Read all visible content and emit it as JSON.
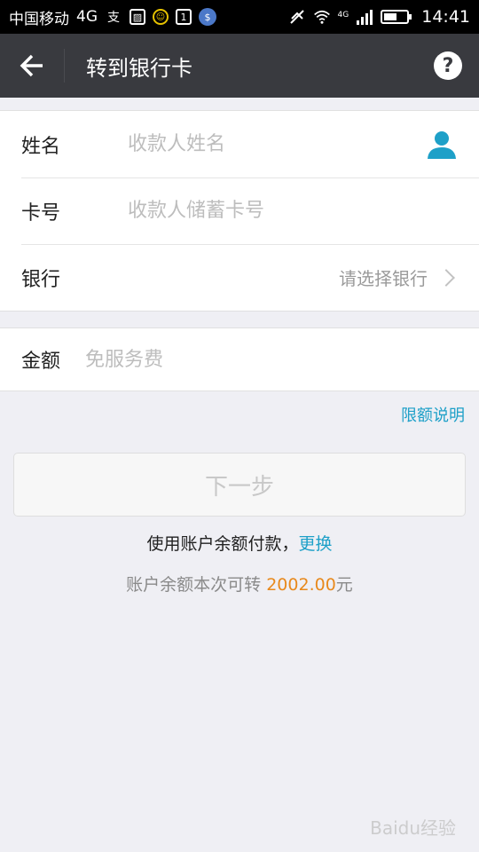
{
  "status_bar": {
    "carrier": "中国移动",
    "network": "4G",
    "network_small": "4G",
    "time": "14:41",
    "icons": [
      "zhifubao-icon",
      "image-icon",
      "smiley-icon",
      "sim-icon",
      "shield-icon",
      "mute-icon",
      "wifi-icon",
      "signal-icon",
      "battery-icon"
    ]
  },
  "header": {
    "title": "转到银行卡",
    "help_label": "?"
  },
  "form": {
    "name_label": "姓名",
    "name_placeholder": "收款人姓名",
    "card_label": "卡号",
    "card_placeholder": "收款人储蓄卡号",
    "bank_label": "银行",
    "bank_select_text": "请选择银行"
  },
  "amount": {
    "label": "金额",
    "placeholder": "免服务费"
  },
  "limit_link": "限额说明",
  "next_button": "下一步",
  "payment": {
    "text": "使用账户余额付款，",
    "change_link": "更换",
    "balance_prefix": "账户余额本次可转 ",
    "balance_amount": "2002.00",
    "balance_suffix": "元"
  },
  "watermark": "Baidu经验",
  "colors": {
    "title_bar": "#393a3f",
    "link": "#1ea0c8",
    "amount": "#e8891c",
    "person_icon": "#1ea0c8"
  }
}
